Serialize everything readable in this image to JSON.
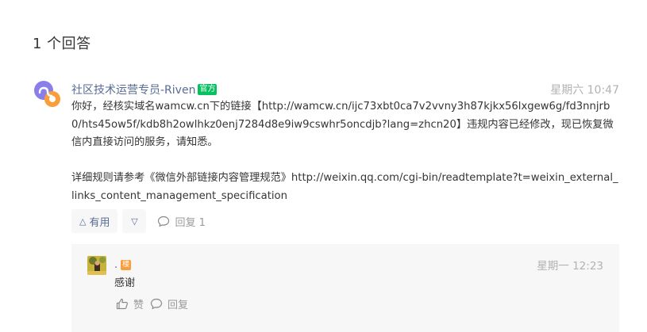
{
  "answers_count_label": "1 个回答",
  "answer": {
    "author": "社区技术运营专员-Riven",
    "badge": "官方",
    "time": "星期六 10:47",
    "paragraph1": "你好，经核实域名wamcw.cn下的链接【http://wamcw.cn/ijc73xbt0ca7v2vvny3h87kjkx56lxgew6g/fd3nnjrb0/hts45ow5f/kdb8h2owlhkz0enj7284d8e9iw9cswhr5oncdjb?lang=zhcn20】违规内容已经修改，现已恢复微信内直接访问的服务，请知悉。",
    "paragraph2": "详细规则请参考《微信外部链接内容管理规范》http://weixin.qq.com/cgi-bin/readtemplate?t=weixin_external_links_content_management_specification",
    "useful_label": "有用",
    "reply_label": "回复 1"
  },
  "reply": {
    "user": ".",
    "op_badge": "楼",
    "time": "星期一 12:23",
    "text": "感谢",
    "like_label": "赞",
    "reply_label": "回复"
  },
  "colors": {
    "link_blue": "#576b95",
    "official_green": "#07c160",
    "op_orange": "#fa9d3b",
    "muted_gray": "#b2b2b2"
  },
  "icons": {
    "answer_avatar": "mini-program-logo-icon",
    "upvote": "triangle-up-icon",
    "downvote": "triangle-down-icon",
    "comment": "comment-bubble-icon",
    "like": "thumbs-up-icon"
  }
}
